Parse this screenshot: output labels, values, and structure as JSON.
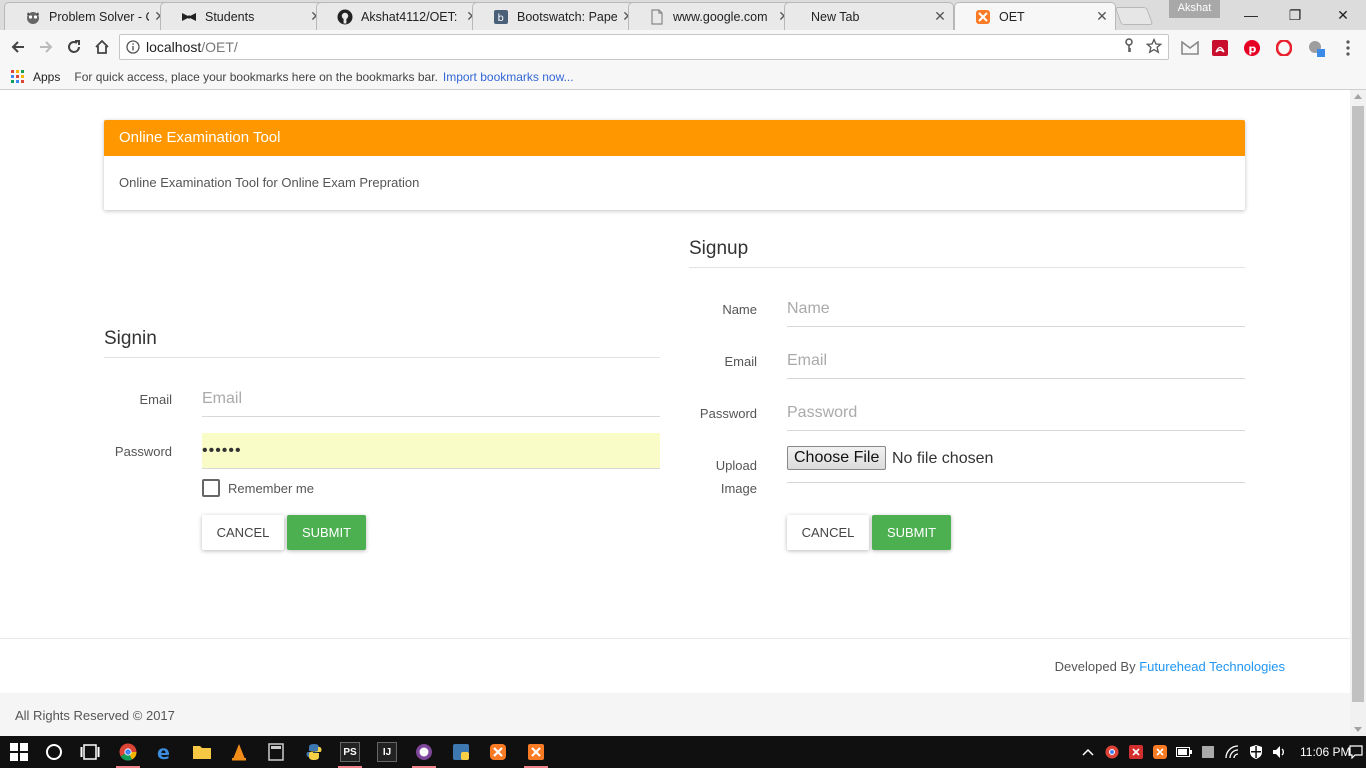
{
  "browser": {
    "tabs": [
      {
        "title": "Problem Solver - C",
        "icon": "raccoon-icon",
        "active": false
      },
      {
        "title": "Students",
        "icon": "bow-tie-icon",
        "active": false
      },
      {
        "title": "Akshat4112/OET: \\",
        "icon": "github-icon",
        "active": false
      },
      {
        "title": "Bootswatch: Pape",
        "icon": "bootswatch-icon",
        "active": false
      },
      {
        "title": "www.google.com",
        "icon": "page-icon",
        "active": false
      },
      {
        "title": "New Tab",
        "icon": "none",
        "active": false
      },
      {
        "title": "OET",
        "icon": "xampp-icon",
        "active": true
      }
    ],
    "profile_name": "Akshat",
    "url_host": "localhost",
    "url_path": "/OET/",
    "bookmarks": {
      "apps_label": "Apps",
      "hint": "For quick access, place your bookmarks here on the bookmarks bar.",
      "import_link": "Import bookmarks now..."
    }
  },
  "panel": {
    "heading": "Online Examination Tool",
    "body": "Online Examination Tool for Online Exam Prepration",
    "heading_color": "#ff9800"
  },
  "signin": {
    "title": "Signin",
    "email_label": "Email",
    "email_placeholder": "Email",
    "password_label": "Password",
    "password_value": "••••••",
    "remember_label": "Remember me",
    "cancel_label": "Cancel",
    "submit_label": "Submit"
  },
  "signup": {
    "title": "Signup",
    "name_label": "Name",
    "name_placeholder": "Name",
    "email_label": "Email",
    "email_placeholder": "Email",
    "password_label": "Password",
    "password_placeholder": "Password",
    "upload_label_1": "Upload",
    "upload_label_2": "Image",
    "choose_file_label": "Choose File",
    "file_status": "No file chosen",
    "cancel_label": "Cancel",
    "submit_label": "Submit"
  },
  "footer": {
    "developed_by": "Developed By",
    "developer": "Futurehead Technologies",
    "copyright": "All Rights Reserved © 2017"
  },
  "taskbar": {
    "clock": "11:06 PM"
  },
  "colors": {
    "accent": "#ff9800",
    "success": "#4caf50",
    "link": "#2196f3"
  }
}
